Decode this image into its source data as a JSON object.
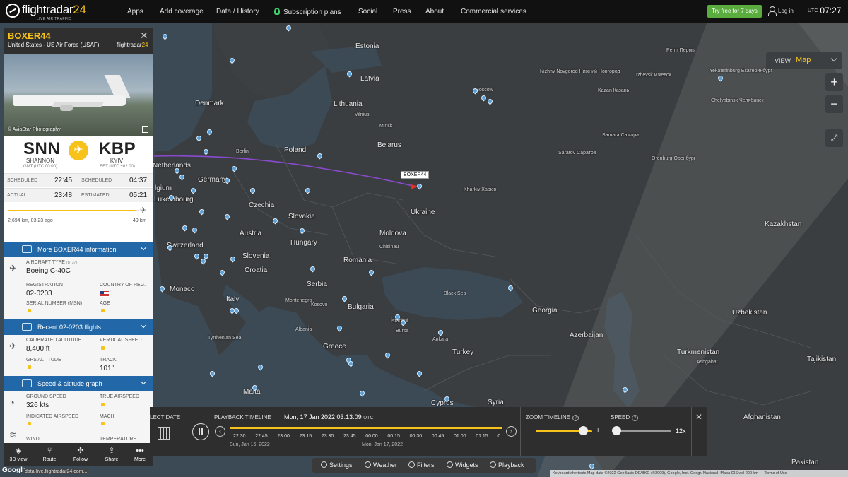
{
  "topbar": {
    "logo_name": "flightradar",
    "logo_num": "24",
    "logo_tag": "LIVE AIR TRAFFIC",
    "nav": [
      "Apps",
      "Add coverage",
      "Data / History",
      "Subscription plans",
      "Social",
      "Press",
      "About",
      "Commercial services"
    ],
    "try_free": "Try free for 7 days",
    "login": "Log in",
    "clock_zone": "UTC",
    "clock_time": "07:27"
  },
  "map": {
    "view_label": "VIEW",
    "view_value": "Map",
    "zoom_in": "+",
    "zoom_out": "−",
    "labels": {
      "estonia": "Estonia",
      "latvia": "Latvia",
      "lithuania": "Lithuania",
      "vilnius": "Vilnius",
      "belarus": "Belarus",
      "minsk": "Minsk",
      "poland": "Poland",
      "denmark": "Denmark",
      "netherlands": "Netherlands",
      "belgium": "lgium",
      "luxembourg": "Luxembourg",
      "germany": "Germany",
      "berlin": "Berlin",
      "czechia": "Czechia",
      "slovakia": "Slovakia",
      "austria": "Austria",
      "switzerland": "Switzerland",
      "hungary": "Hungary",
      "slovenia": "Slovenia",
      "croatia": "Croatia",
      "monaco": "Monaco",
      "italy": "Italy",
      "serbia": "Serbia",
      "romania": "Romania",
      "moldova": "Moldova",
      "chisinau": "Chisinau",
      "ukraine": "Ukraine",
      "kharkiv": "Kharkiv Харків",
      "bulgaria": "Bulgaria",
      "montenegro": "Montenegro",
      "kosovo": "Kosovo",
      "albania": "Albania",
      "greece": "Greece",
      "turkey": "Turkey",
      "georgia": "Georgia",
      "azerbaijan": "Azerbaijan",
      "kazakhstan": "Kazakhstan",
      "uzbekistan": "Uzbekistan",
      "turkmenistan": "Turkmenistan",
      "ashgabat": "Ashgabat",
      "tajikistan": "Tajikistan",
      "afghanistan": "Afghanistan",
      "pakistan": "Pakistan",
      "syria": "Syria",
      "cyprus": "Cyprus",
      "malta": "Malta",
      "black_sea": "Black Sea",
      "tyrrhenian": "Tyrrhenian Sea",
      "moscow": "Moscow",
      "nizhny": "Nizhny Novgorod Нижний Новгород",
      "kazan": "Kazan Казань",
      "izhevsk": "Izhevsk Ижевск",
      "perm": "Perm Пермь",
      "yekaterinburg": "Yekaterinburg Екатеринбург",
      "chelyabinsk": "Chelyabinsk Челябинск",
      "samara": "Samara Самара",
      "saratov": "Saratov Саратов",
      "orenburg": "Orenburg Оренбург",
      "bursa": "Bursa",
      "istanbul": "İstanbul",
      "ankara": "Ankara"
    },
    "tracked_label": "BOXER44"
  },
  "panel": {
    "callsign": "BOXER44",
    "operator": "United States - US Air Force (USAF)",
    "brand_a": "flightradar",
    "brand_b": "24",
    "photo_credit": "© AviaStar Photography",
    "origin": {
      "code": "SNN",
      "city": "SHANNON",
      "tz": "GMT (UTC 00:00)"
    },
    "destination": {
      "code": "KBP",
      "city": "KYIV",
      "tz": "EET (UTC +02:00)"
    },
    "times": {
      "scheduled_label": "SCHEDULED",
      "dep_scheduled": "22:45",
      "arr_scheduled": "04:37",
      "actual_label": "ACTUAL",
      "dep_actual": "23:48",
      "estimated_label": "ESTIMATED",
      "arr_estimated": "05:21"
    },
    "progress": {
      "left": "2,694 km, 03:23 ago",
      "right": "49 km",
      "fraction": 0.98
    },
    "sections": {
      "more_info": "More BOXER44 information",
      "recent": "Recent 02-0203 flights",
      "speed_alt": "Speed & altitude graph"
    },
    "aircraft": {
      "type_label": "AIRCRAFT TYPE",
      "type_code": "(B737)",
      "type_value": "Boeing C-40C",
      "reg_label": "REGISTRATION",
      "reg_value": "02-0203",
      "country_label": "COUNTRY OF REG.",
      "msn_label": "SERIAL NUMBER (MSN)",
      "age_label": "AGE"
    },
    "flight": {
      "calt_label": "CALIBRATED ALTITUDE",
      "calt_value": "8,400 ft",
      "vspeed_label": "VERTICAL SPEED",
      "gps_label": "GPS ALTITUDE",
      "track_label": "TRACK",
      "track_value": "101°"
    },
    "speed": {
      "gs_label": "GROUND SPEED",
      "gs_value": "326 kts",
      "tas_label": "TRUE AIRSPEED",
      "ias_label": "INDICATED AIRSPEED",
      "mach_label": "MACH",
      "wind_label": "WIND",
      "temp_label": "TEMPERATURE"
    },
    "footer": [
      "3D view",
      "Route",
      "Follow",
      "Share",
      "More"
    ]
  },
  "playback": {
    "select_date": "LECT DATE",
    "title": "PLAYBACK TIMELINE",
    "current_date": "Mon, 17 Jan 2022 03:13:09",
    "current_zone": "UTC",
    "ticks": [
      "22:30",
      "22:45",
      "23:00",
      "23:15",
      "23:30",
      "23:45",
      "00:00",
      "00:15",
      "00:30",
      "00:45",
      "01:00",
      "01:15",
      "0"
    ],
    "day_a": "Sun, Jan 16, 2022",
    "day_b": "Mon, Jan 17, 2022",
    "zoom_label": "ZOOM TIMELINE",
    "speed_label": "SPEED",
    "speed_value": "12x",
    "help": "?"
  },
  "toolbar": [
    "Settings",
    "Weather",
    "Filters",
    "Widgets",
    "Playback"
  ],
  "attribution": "Keyboard shortcuts   Map data ©2022 GeoBasis-DE/BKG (©2009), Google, Inst. Geogr. Nacional, Mapa GISrael   200 km ⎯⎯   Terms of Use",
  "google": "Google",
  "status_url": "data-live.flightradar24.com..."
}
